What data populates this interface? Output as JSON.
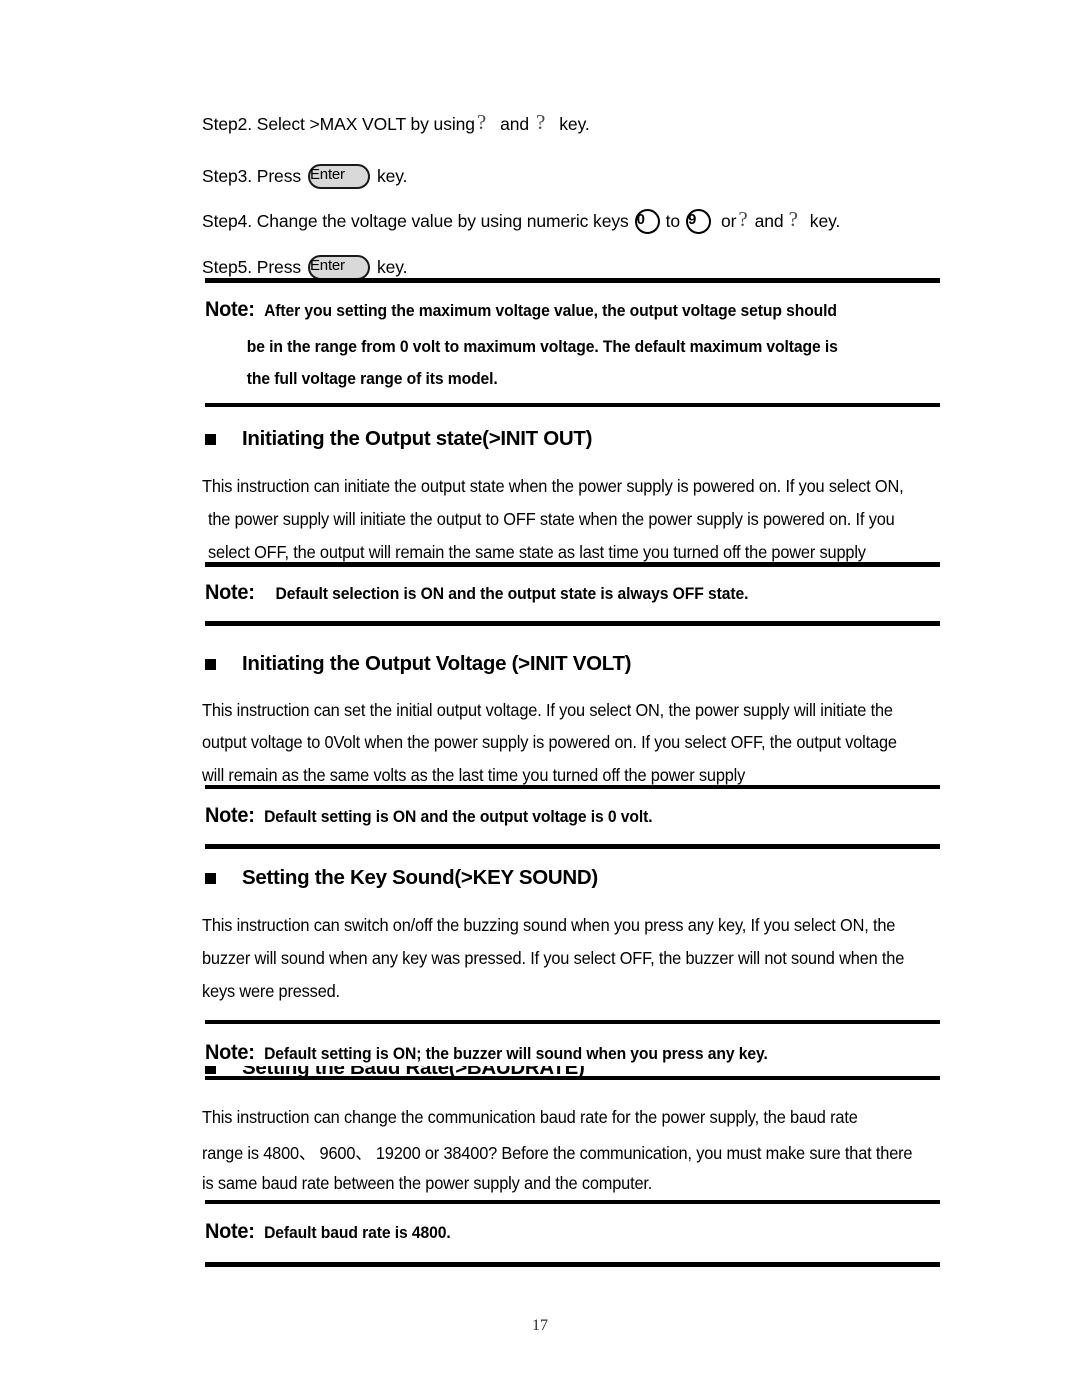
{
  "document": {
    "page_number": "17"
  },
  "steps": [
    {
      "id": "step2",
      "prefix": "Step2. Select >MAX VOLT by using",
      "glyph1": "?",
      "mid": "and",
      "glyph2": "?",
      "suffix": "key."
    },
    {
      "id": "step3",
      "prefix": "Step3. Press",
      "key_label": "Enter",
      "suffix": "key."
    },
    {
      "id": "step4",
      "prefix": "Step4. Change the voltage value by using numeric keys",
      "key_from": "0",
      "to_word": "to",
      "key_to": "9",
      "or_word": "or",
      "glyph1": "?",
      "mid": "and",
      "glyph2": "?",
      "suffix": "key."
    },
    {
      "id": "step5",
      "prefix": "Step5. Press",
      "key_label": "Enter",
      "suffix": "key."
    }
  ],
  "note_max_volt": {
    "label": "Note:",
    "lines": [
      "After you setting the maximum voltage value, the output voltage setup should",
      "be in the range from 0 volt to maximum voltage. The default maximum voltage is",
      "the full voltage range of its model."
    ]
  },
  "section_init_out": {
    "heading": "Initiating the Output state(>INIT OUT)",
    "paragraph_lines": [
      "This instruction can initiate the output state when the power supply is powered on. If you select ON,",
      "the power supply will initiate the output to OFF state when the power supply is powered on. If you",
      "select OFF, the output will remain the same state as last time you turned off the power supply"
    ],
    "note": {
      "label": "Note:",
      "text": "Default selection is ON and the output state is always OFF state."
    }
  },
  "section_init_volt": {
    "heading": "Initiating the Output Voltage (>INIT VOLT)",
    "paragraph_lines": [
      "This instruction can set the initial output voltage. If you select ON, the power supply will initiate the",
      "output voltage to 0Volt when the power supply is powered on. If you select OFF, the output voltage",
      " will remain as the same volts as the last time you turned off the power supply"
    ],
    "note": {
      "label": "Note:",
      "text": "Default setting is ON and the output voltage is 0 volt."
    }
  },
  "section_key_sound": {
    "heading": "Setting the Key Sound(>KEY SOUND)",
    "paragraph_lines": [
      "This instruction can switch on/off the buzzing sound when you press any key, If you select ON, the",
      "buzzer will sound when any key was pressed. If you select OFF, the buzzer will not sound when the",
      "keys were pressed."
    ],
    "note": {
      "label": "Note:",
      "text": "Default setting is ON; the buzzer will sound when you press any key."
    }
  },
  "section_baud_rate": {
    "heading": "Setting the Baud Rate(>BAUDRATE)",
    "paragraph_lines": [
      "This instruction can change the communication baud rate for the power supply,    the baud rate",
      "range is 4800、 9600、 19200 or 38400? Before the communication, you must make sure that there",
      "is same baud rate between the power supply and the computer."
    ],
    "note": {
      "label": "Note:",
      "text": "Default baud rate is 4800."
    }
  }
}
